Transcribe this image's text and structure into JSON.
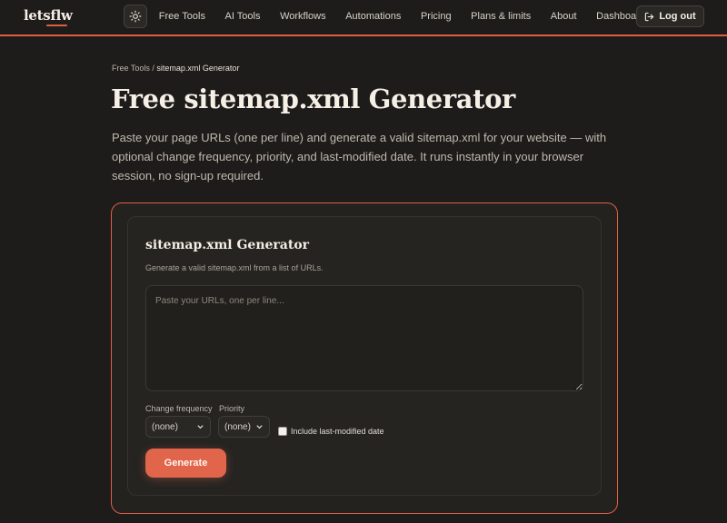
{
  "header": {
    "logo_left": "lets",
    "logo_right": "flw",
    "theme_toggle_icon": "sun-icon",
    "nav": [
      {
        "label": "Free Tools"
      },
      {
        "label": "AI Tools"
      },
      {
        "label": "Workflows"
      },
      {
        "label": "Automations"
      },
      {
        "label": "Pricing"
      },
      {
        "label": "Plans & limits"
      },
      {
        "label": "About"
      },
      {
        "label": "Dashboard"
      }
    ],
    "logout_label": "Log out",
    "logout_icon": "logout-icon",
    "accent": "#e05f44"
  },
  "breadcrumb": {
    "parent": "Free Tools",
    "separator": "/",
    "current": "sitemap.xml Generator"
  },
  "page": {
    "title": "Free sitemap.xml Generator",
    "intro": "Paste your page URLs (one per line) and generate a valid sitemap.xml for your website — with optional change frequency, priority, and last-modified date. It runs instantly in your browser session, no sign-up required."
  },
  "tool": {
    "title": "sitemap.xml Generator",
    "subtitle": "Generate a valid sitemap.xml from a list of URLs.",
    "urls_value": "",
    "urls_placeholder": "Paste your URLs, one per line...",
    "changefreq_label": "Change frequency",
    "changefreq_value": "(none)",
    "priority_label": "Priority",
    "priority_value": "(none)",
    "lastmod_label": "Include last-modified date",
    "lastmod_checked": false,
    "generate_label": "Generate"
  }
}
